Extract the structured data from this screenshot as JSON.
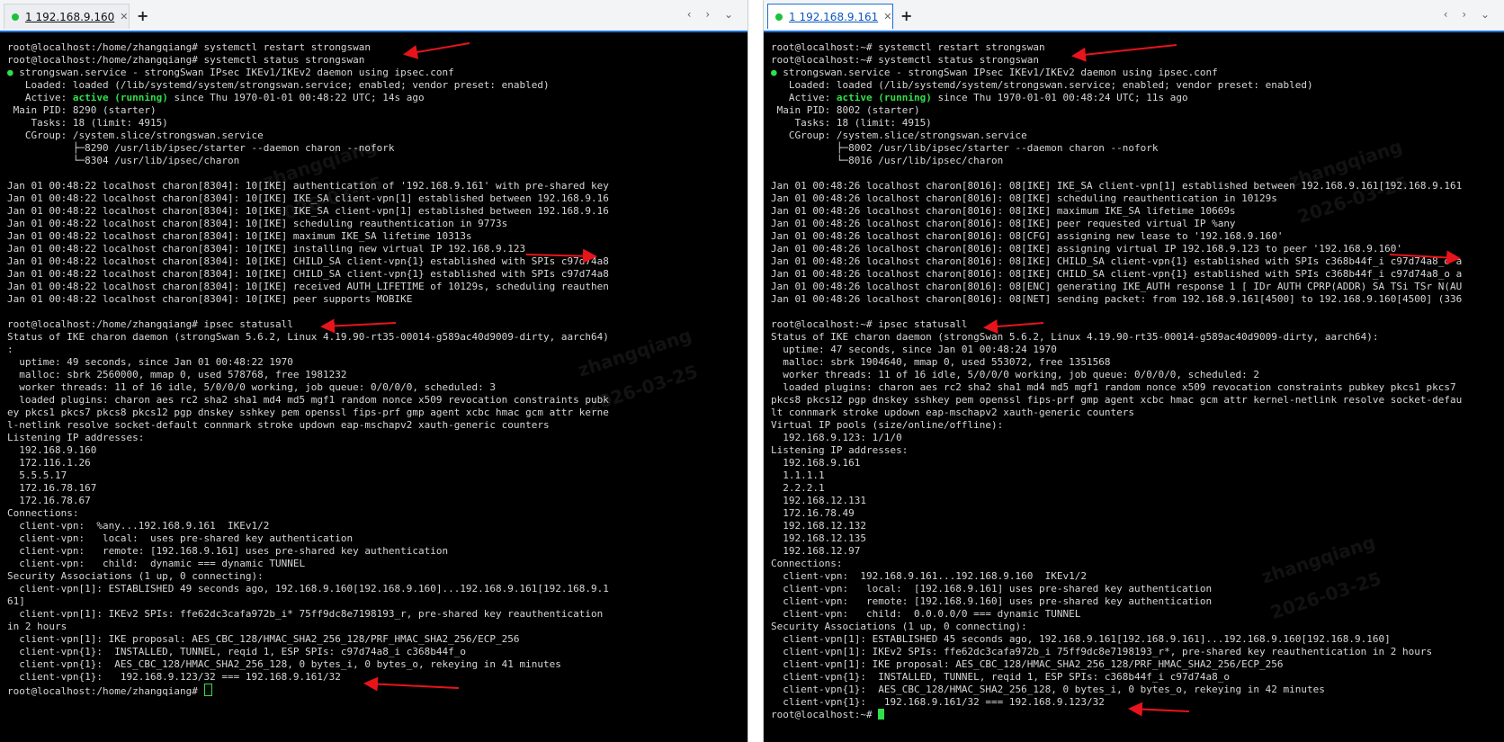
{
  "left": {
    "tab_label": "1 192.168.9.160",
    "tab_close": "✕",
    "new_tab": "+",
    "nav_arrows": "‹ › ⌄",
    "lines": [
      "root@localhost:/home/zhangqiang# systemctl restart strongswan",
      "root@localhost:/home/zhangqiang# systemctl status strongswan",
      " strongswan.service - strongSwan IPsec IKEv1/IKEv2 daemon using ipsec.conf",
      "   Loaded: loaded (/lib/systemd/system/strongswan.service; enabled; vendor preset: enabled)",
      "   Active: active (running) since Thu 1970-01-01 00:48:22 UTC; 14s ago",
      " Main PID: 8290 (starter)",
      "    Tasks: 18 (limit: 4915)",
      "   CGroup: /system.slice/strongswan.service",
      "           ├─8290 /usr/lib/ipsec/starter --daemon charon --nofork",
      "           └─8304 /usr/lib/ipsec/charon",
      "",
      "Jan 01 00:48:22 localhost charon[8304]: 10[IKE] authentication of '192.168.9.161' with pre-shared key",
      "Jan 01 00:48:22 localhost charon[8304]: 10[IKE] IKE_SA client-vpn[1] established between 192.168.9.16",
      "Jan 01 00:48:22 localhost charon[8304]: 10[IKE] IKE_SA client-vpn[1] established between 192.168.9.16",
      "Jan 01 00:48:22 localhost charon[8304]: 10[IKE] scheduling reauthentication in 9773s",
      "Jan 01 00:48:22 localhost charon[8304]: 10[IKE] maximum IKE_SA lifetime 10313s",
      "Jan 01 00:48:22 localhost charon[8304]: 10[IKE] installing new virtual IP 192.168.9.123",
      "Jan 01 00:48:22 localhost charon[8304]: 10[IKE] CHILD_SA client-vpn{1} established with SPIs c97d74a8",
      "Jan 01 00:48:22 localhost charon[8304]: 10[IKE] CHILD_SA client-vpn{1} established with SPIs c97d74a8",
      "Jan 01 00:48:22 localhost charon[8304]: 10[IKE] received AUTH_LIFETIME of 10129s, scheduling reauthen",
      "Jan 01 00:48:22 localhost charon[8304]: 10[IKE] peer supports MOBIKE",
      "",
      "root@localhost:/home/zhangqiang# ipsec statusall",
      "Status of IKE charon daemon (strongSwan 5.6.2, Linux 4.19.90-rt35-00014-g589ac40d9009-dirty, aarch64)",
      ":",
      "  uptime: 49 seconds, since Jan 01 00:48:22 1970",
      "  malloc: sbrk 2560000, mmap 0, used 578768, free 1981232",
      "  worker threads: 11 of 16 idle, 5/0/0/0 working, job queue: 0/0/0/0, scheduled: 3",
      "  loaded plugins: charon aes rc2 sha2 sha1 md4 md5 mgf1 random nonce x509 revocation constraints pubk",
      "ey pkcs1 pkcs7 pkcs8 pkcs12 pgp dnskey sshkey pem openssl fips-prf gmp agent xcbc hmac gcm attr kerne",
      "l-netlink resolve socket-default connmark stroke updown eap-mschapv2 xauth-generic counters",
      "Listening IP addresses:",
      "  192.168.9.160",
      "  172.116.1.26",
      "  5.5.5.17",
      "  172.16.78.167",
      "  172.16.78.67",
      "Connections:",
      "  client-vpn:  %any...192.168.9.161  IKEv1/2",
      "  client-vpn:   local:  uses pre-shared key authentication",
      "  client-vpn:   remote: [192.168.9.161] uses pre-shared key authentication",
      "  client-vpn:   child:  dynamic === dynamic TUNNEL",
      "Security Associations (1 up, 0 connecting):",
      "  client-vpn[1]: ESTABLISHED 49 seconds ago, 192.168.9.160[192.168.9.160]...192.168.9.161[192.168.9.1",
      "61]",
      "  client-vpn[1]: IKEv2 SPIs: ffe62dc3cafa972b_i* 75ff9dc8e7198193_r, pre-shared key reauthentication",
      "in 2 hours",
      "  client-vpn[1]: IKE proposal: AES_CBC_128/HMAC_SHA2_256_128/PRF_HMAC_SHA2_256/ECP_256",
      "  client-vpn{1}:  INSTALLED, TUNNEL, reqid 1, ESP SPIs: c97d74a8_i c368b44f_o",
      "  client-vpn{1}:  AES_CBC_128/HMAC_SHA2_256_128, 0 bytes_i, 0 bytes_o, rekeying in 41 minutes",
      "  client-vpn{1}:   192.168.9.123/32 === 192.168.9.161/32",
      "root@localhost:/home/zhangqiang# "
    ]
  },
  "right": {
    "tab_label": "1 192.168.9.161",
    "tab_close": "✕",
    "new_tab": "+",
    "nav_arrows": "‹ › ⌄",
    "lines": [
      "root@localhost:~# systemctl restart strongswan",
      "root@localhost:~# systemctl status strongswan",
      " strongswan.service - strongSwan IPsec IKEv1/IKEv2 daemon using ipsec.conf",
      "   Loaded: loaded (/lib/systemd/system/strongswan.service; enabled; vendor preset: enabled)",
      "   Active: active (running) since Thu 1970-01-01 00:48:24 UTC; 11s ago",
      " Main PID: 8002 (starter)",
      "    Tasks: 18 (limit: 4915)",
      "   CGroup: /system.slice/strongswan.service",
      "           ├─8002 /usr/lib/ipsec/starter --daemon charon --nofork",
      "           └─8016 /usr/lib/ipsec/charon",
      "",
      "Jan 01 00:48:26 localhost charon[8016]: 08[IKE] IKE_SA client-vpn[1] established between 192.168.9.161[192.168.9.161",
      "Jan 01 00:48:26 localhost charon[8016]: 08[IKE] scheduling reauthentication in 10129s",
      "Jan 01 00:48:26 localhost charon[8016]: 08[IKE] maximum IKE_SA lifetime 10669s",
      "Jan 01 00:48:26 localhost charon[8016]: 08[IKE] peer requested virtual IP %any",
      "Jan 01 00:48:26 localhost charon[8016]: 08[CFG] assigning new lease to '192.168.9.160'",
      "Jan 01 00:48:26 localhost charon[8016]: 08[IKE] assigning virtual IP 192.168.9.123 to peer '192.168.9.160'",
      "Jan 01 00:48:26 localhost charon[8016]: 08[IKE] CHILD_SA client-vpn{1} established with SPIs c368b44f_i c97d74a8_o a",
      "Jan 01 00:48:26 localhost charon[8016]: 08[IKE] CHILD_SA client-vpn{1} established with SPIs c368b44f_i c97d74a8_o a",
      "Jan 01 00:48:26 localhost charon[8016]: 08[ENC] generating IKE_AUTH response 1 [ IDr AUTH CPRP(ADDR) SA TSi TSr N(AU",
      "Jan 01 00:48:26 localhost charon[8016]: 08[NET] sending packet: from 192.168.9.161[4500] to 192.168.9.160[4500] (336",
      "",
      "root@localhost:~# ipsec statusall",
      "Status of IKE charon daemon (strongSwan 5.6.2, Linux 4.19.90-rt35-00014-g589ac40d9009-dirty, aarch64):",
      "  uptime: 47 seconds, since Jan 01 00:48:24 1970",
      "  malloc: sbrk 1904640, mmap 0, used 553072, free 1351568",
      "  worker threads: 11 of 16 idle, 5/0/0/0 working, job queue: 0/0/0/0, scheduled: 2",
      "  loaded plugins: charon aes rc2 sha2 sha1 md4 md5 mgf1 random nonce x509 revocation constraints pubkey pkcs1 pkcs7",
      "pkcs8 pkcs12 pgp dnskey sshkey pem openssl fips-prf gmp agent xcbc hmac gcm attr kernel-netlink resolve socket-defau",
      "lt connmark stroke updown eap-mschapv2 xauth-generic counters",
      "Virtual IP pools (size/online/offline):",
      "  192.168.9.123: 1/1/0",
      "Listening IP addresses:",
      "  192.168.9.161",
      "  1.1.1.1",
      "  2.2.2.1",
      "  192.168.12.131",
      "  172.16.78.49",
      "  192.168.12.132",
      "  192.168.12.135",
      "  192.168.12.97",
      "Connections:",
      "  client-vpn:  192.168.9.161...192.168.9.160  IKEv1/2",
      "  client-vpn:   local:  [192.168.9.161] uses pre-shared key authentication",
      "  client-vpn:   remote: [192.168.9.160] uses pre-shared key authentication",
      "  client-vpn:   child:  0.0.0.0/0 === dynamic TUNNEL",
      "Security Associations (1 up, 0 connecting):",
      "  client-vpn[1]: ESTABLISHED 45 seconds ago, 192.168.9.161[192.168.9.161]...192.168.9.160[192.168.9.160]",
      "  client-vpn[1]: IKEv2 SPIs: ffe62dc3cafa972b_i 75ff9dc8e7198193_r*, pre-shared key reauthentication in 2 hours",
      "  client-vpn[1]: IKE proposal: AES_CBC_128/HMAC_SHA2_256_128/PRF_HMAC_SHA2_256/ECP_256",
      "  client-vpn{1}:  INSTALLED, TUNNEL, reqid 1, ESP SPIs: c368b44f_i c97d74a8_o",
      "  client-vpn{1}:  AES_CBC_128/HMAC_SHA2_256_128, 0 bytes_i, 0 bytes_o, rekeying in 42 minutes",
      "  client-vpn{1}:   192.168.9.161/32 === 192.168.9.123/32",
      "root@localhost:~# "
    ]
  },
  "watermarks": [
    "zhangqiang",
    "2026-03-25"
  ],
  "colors": {
    "accent_green": "#2fe04a",
    "arrow_red": "#e8141b",
    "tab_active_blue": "#1b6fd6"
  }
}
